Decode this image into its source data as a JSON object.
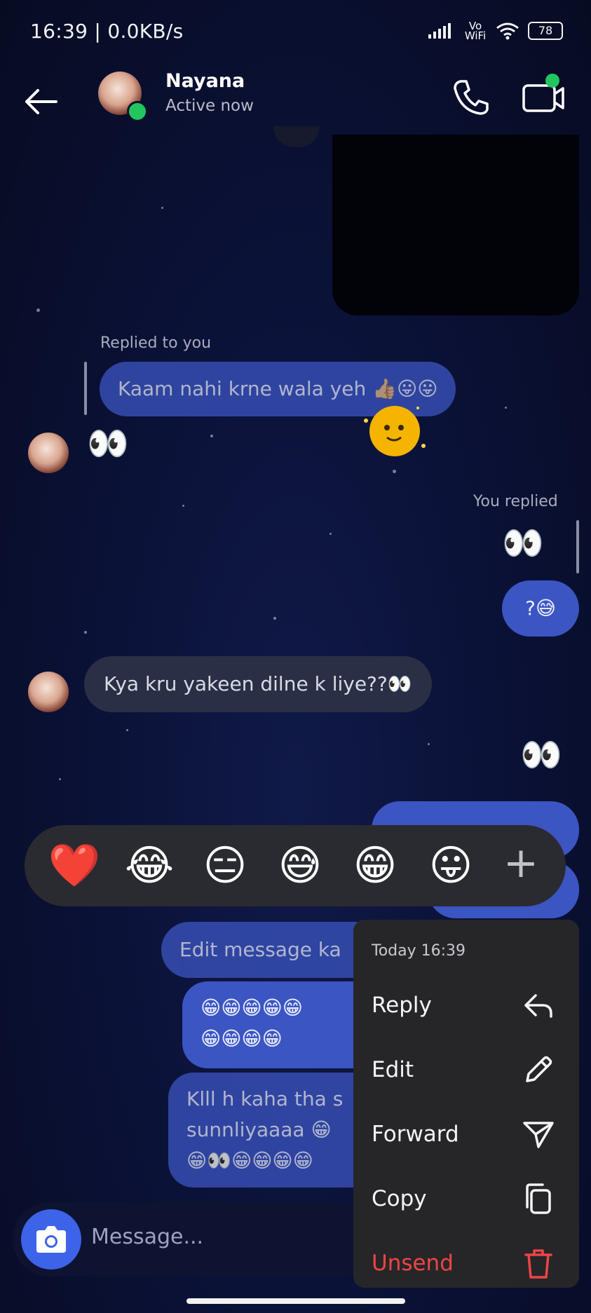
{
  "status_bar": {
    "time": "16:39 | 0.0KB/s",
    "network": "Vo WiFi",
    "battery": "78"
  },
  "header": {
    "contact_name": "Nayana",
    "contact_status": "Active now"
  },
  "messages": {
    "replied_to_you": "Replied to you",
    "quoted_text": "Kaam nahi krne wala yeh 👍🏼😛😛",
    "eyes_1": "👀",
    "you_replied": "You replied",
    "eyes_2": "👀",
    "question": "?😅",
    "kya_kru": "Kya kru yakeen dilne k liye??👀",
    "eyes_3": "👀",
    "edit_message_partial": "Edit message ka",
    "grin_line_1": "😁😁😁😁😁",
    "grin_line_2": "😁😁😁😁",
    "klll_line_1": "Klll h kaha tha s",
    "klll_line_2": "sunnliyaaaa 😁",
    "klll_line_3": "😁👀😁😁😁😁"
  },
  "reactions": [
    "❤️",
    "😂",
    "😑",
    "😅",
    "😁",
    "😛"
  ],
  "reaction_plus": "+",
  "context_menu": {
    "timestamp": "Today 16:39",
    "items": [
      {
        "label": "Reply",
        "icon": "reply-icon"
      },
      {
        "label": "Edit",
        "icon": "pencil-icon"
      },
      {
        "label": "Forward",
        "icon": "send-icon"
      },
      {
        "label": "Copy",
        "icon": "copy-icon"
      },
      {
        "label": "Unsend",
        "icon": "trash-icon"
      }
    ],
    "danger_color": "#ef4444"
  },
  "composer": {
    "placeholder": "Message..."
  }
}
